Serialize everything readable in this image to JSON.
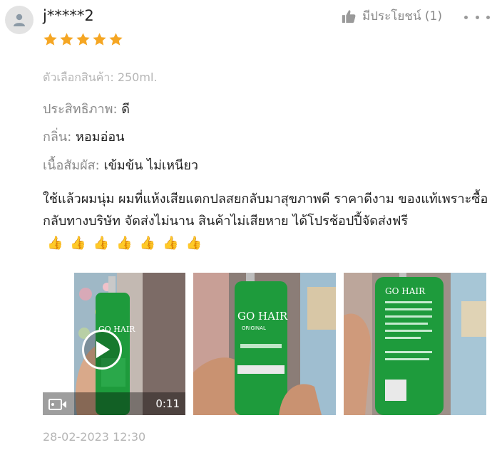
{
  "review": {
    "username": "j*****2",
    "rating": 5,
    "helpful": {
      "label": "มีประโยชน์ (1)"
    },
    "variation": "ตัวเลือกสินค้า: 250ml.",
    "attributes": [
      {
        "key": "ประสิทธิภาพ:",
        "value": "ดี"
      },
      {
        "key": "กลิ่น:",
        "value": "หอมอ่อน"
      },
      {
        "key": "เนื้อสัมผัส:",
        "value": "เข้มข้น ไม่เหนียว"
      }
    ],
    "comment": "ใช้แล้วผมนุ่ม ผมที่แห้งเสียแตกปลสยกลับมาสุขภาพดี ราคาดีงาม ของแท้เพราะซื้อกลับทางบริษัท จัดส่งไม่นาน สินค้าไม่เสียหาย ได้โปรช้อปปี้จัดส่งฟรี",
    "comment_emoji": "👍👍👍👍👍👍👍",
    "media": {
      "video_duration": "0:11",
      "bottle_brand": "GO HAIR",
      "bottle_sub": "ORIGINAL"
    },
    "date": "28-02-2023 12:30"
  },
  "colors": {
    "star": "#f5a623",
    "bottle_green": "#1e9b3c",
    "muted_text": "#8a8a8a",
    "light_text": "#b5b5b5"
  },
  "icons": {
    "avatar": "user-silhouette-icon",
    "helpful": "thumbs-up-icon",
    "more": "more-horizontal-icon",
    "video": "video-camera-icon",
    "play": "play-icon"
  }
}
